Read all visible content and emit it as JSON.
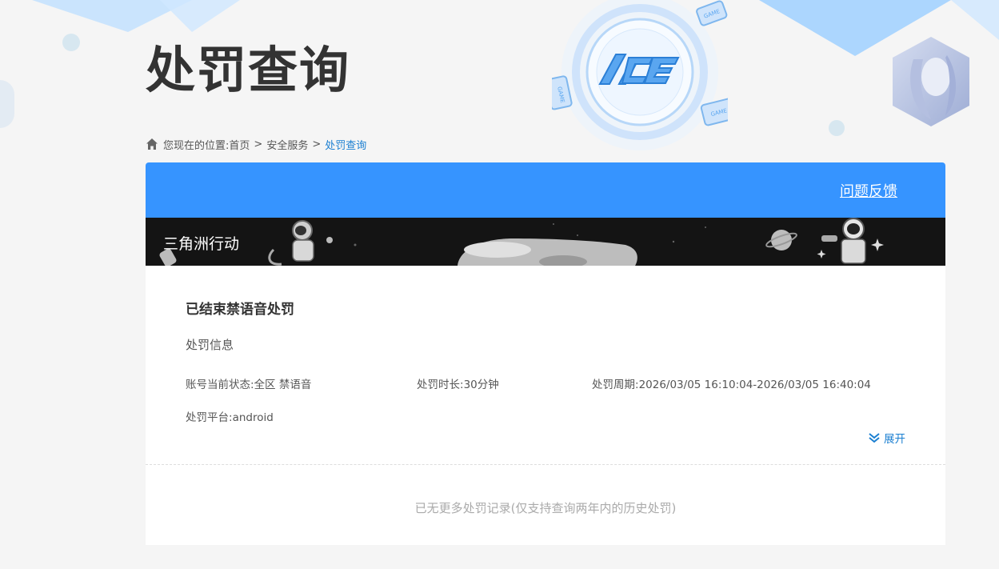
{
  "page": {
    "title": "处罚查询",
    "logo_text": "ACE",
    "game_tag": "GAME"
  },
  "breadcrumb": {
    "prefix": "您现在的位置:",
    "items": [
      "首页",
      "安全服务",
      "处罚查询"
    ],
    "separator": ">"
  },
  "card": {
    "feedback_label": "问题反馈",
    "game_name": "三角洲行动"
  },
  "record": {
    "title": "已结束禁语音处罚",
    "section_label": "处罚信息",
    "status_label": "账号当前状态:",
    "status_value": "全区 禁语音",
    "duration_label": "处罚时长:",
    "duration_value": "30分钟",
    "period_label": "处罚周期:",
    "period_value": "2026/03/05 16:10:04-2026/03/05 16:40:04",
    "platform_label": "处罚平台:",
    "platform_value": "android",
    "expand_label": "展开"
  },
  "footer": {
    "no_more_text": "已无更多处罚记录(仅支持查询两年内的历史处罚)"
  },
  "colors": {
    "accent": "#3694ff",
    "link": "#1b7fd1",
    "banner_bg": "#141414",
    "page_bg": "#f5f5f5"
  },
  "icons": [
    "home-icon",
    "chevron-double-down-icon",
    "astronaut-icon",
    "planet-icon",
    "gamepad-icon",
    "ace-logo-icon"
  ]
}
